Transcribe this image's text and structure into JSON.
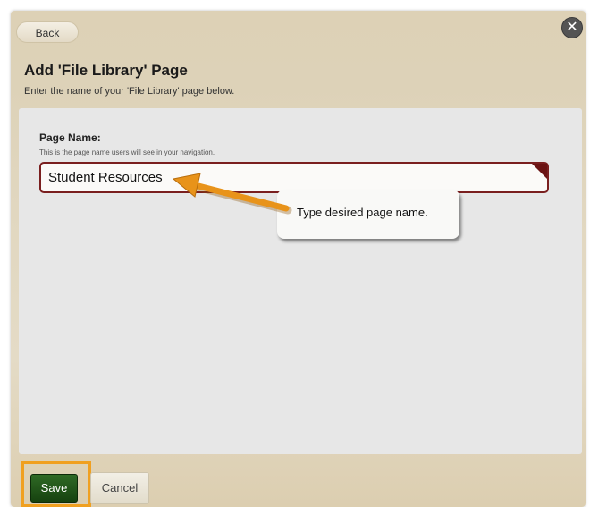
{
  "header": {
    "back_label": "Back",
    "close_symbol": "✕",
    "title": "Add 'File Library' Page",
    "subtitle": "Enter the name of your 'File Library' page below."
  },
  "form": {
    "page_name_label": "Page Name:",
    "page_name_hint": "This is the page name users will see in your navigation.",
    "page_name_value": "Student Resources"
  },
  "annotation": {
    "callout_text": "Type desired page name.",
    "arrow_color": "#e8931a",
    "highlight_color": "#f0a020"
  },
  "footer": {
    "save_label": "Save",
    "cancel_label": "Cancel"
  },
  "colors": {
    "input_border": "#7a1f1f",
    "save_button": "#245a1c",
    "close_button": "#545454"
  },
  "icons": {
    "close": "close-icon",
    "arrow": "arrow-pointer-icon"
  }
}
